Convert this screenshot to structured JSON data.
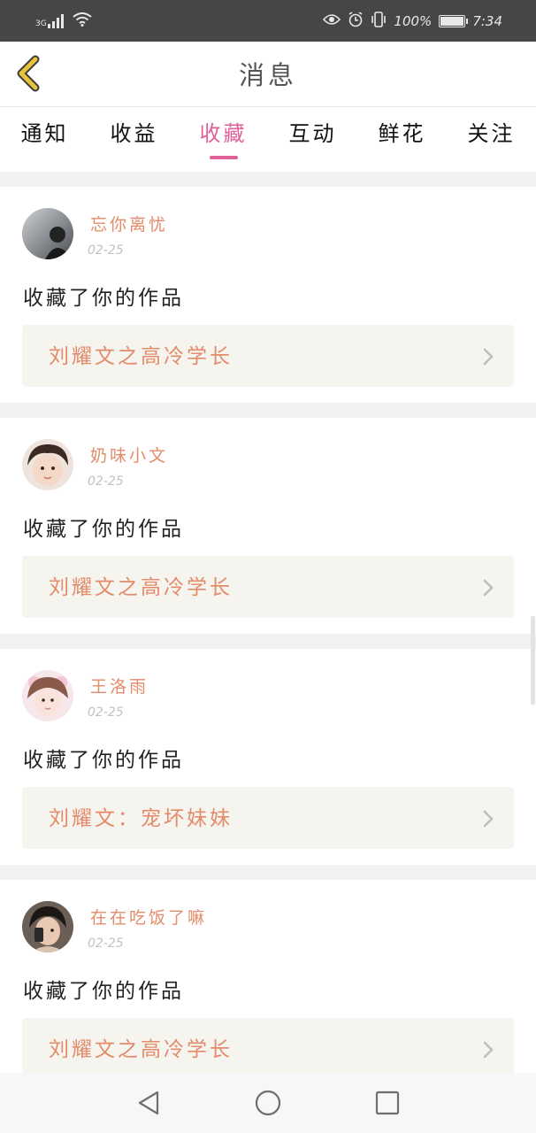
{
  "status_bar": {
    "network": "3G",
    "battery_text": "100%",
    "time": "7:34",
    "battery_level": 1.0,
    "icons": [
      "signal-icon",
      "wifi-icon",
      "eye-icon",
      "alarm-icon",
      "vibrate-icon",
      "battery-icon"
    ]
  },
  "header": {
    "title": "消息",
    "back_icon": "chevron-left-icon"
  },
  "tabs": [
    {
      "label": "通知",
      "active": false
    },
    {
      "label": "收益",
      "active": false
    },
    {
      "label": "收藏",
      "active": true
    },
    {
      "label": "互动",
      "active": false
    },
    {
      "label": "鲜花",
      "active": false
    },
    {
      "label": "关注",
      "active": false
    }
  ],
  "notifications": [
    {
      "username": "忘你离忧",
      "date": "02-25",
      "action": "收藏了你的作品",
      "work_title": "刘耀文之高冷学长"
    },
    {
      "username": "奶味小文",
      "date": "02-25",
      "action": "收藏了你的作品",
      "work_title": "刘耀文之高冷学长"
    },
    {
      "username": "王洛雨",
      "date": "02-25",
      "action": "收藏了你的作品",
      "work_title": "刘耀文：宠坏妹妹"
    },
    {
      "username": "在在吃饭了嘛",
      "date": "02-25",
      "action": "收藏了你的作品",
      "work_title": "刘耀文之高冷学长"
    }
  ],
  "colors": {
    "accent": "#e0609a",
    "username": "#e38b6a",
    "work_box_bg": "#f5f4ee",
    "status_bar_bg": "#464646",
    "back_arrow": "#e8c43a"
  },
  "nav_bar": {
    "icons": [
      "back-triangle-icon",
      "home-circle-icon",
      "recents-square-icon"
    ]
  }
}
